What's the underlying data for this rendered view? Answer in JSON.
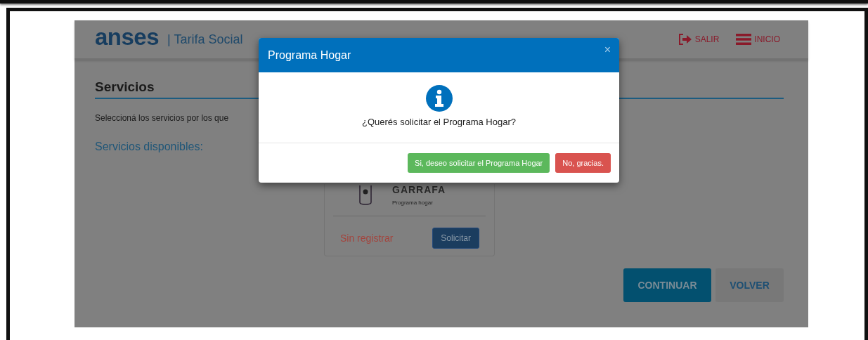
{
  "header": {
    "logo": "anses",
    "subtitle": "| Tarifa Social",
    "links": [
      {
        "kind": "exit",
        "label": "SALIR"
      },
      {
        "kind": "menu",
        "label": "INICIO"
      }
    ]
  },
  "section": {
    "title": "Servicios",
    "intro": "Seleccioná los servicios por los que",
    "available_label": "Servicios disponibles:"
  },
  "service_card": {
    "name": "GARRAFA",
    "subtitle": "Programa hogar",
    "status": "Sin registrar",
    "button": "Solicitar"
  },
  "actions": [
    {
      "kind": "primary",
      "label": "CONTINUAR"
    },
    {
      "kind": "secondary",
      "label": "VOLVER"
    }
  ],
  "modal": {
    "title": "Programa Hogar",
    "close": "×",
    "question": "¿Querés solicitar el Programa Hogar?",
    "buttons": [
      {
        "kind": "success",
        "label": "Si, deseo solicitar el Programa Hogar"
      },
      {
        "kind": "danger",
        "label": "No, gracias."
      }
    ]
  }
}
